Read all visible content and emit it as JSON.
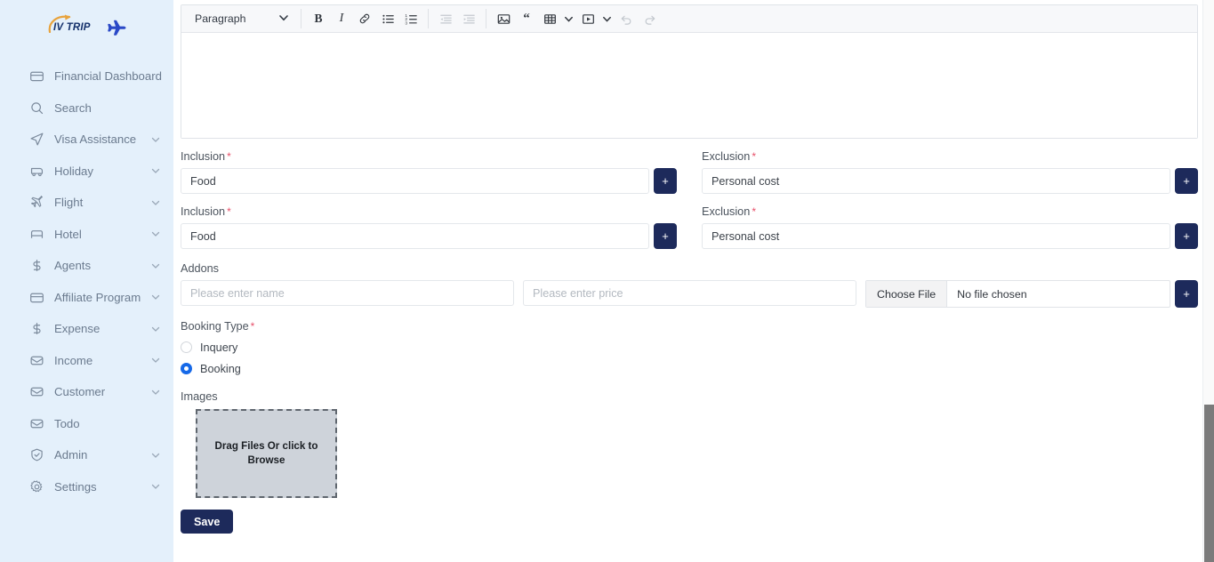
{
  "brand": {
    "name": "IV TRIP",
    "logo_icon": "plane-icon",
    "arc_icon": "curved-arrow-icon",
    "accent_blue": "#1d2a5b",
    "sidebar_bg": "#e4f0fb"
  },
  "sidebar": {
    "items": [
      {
        "label": "Financial Dashboard",
        "icon": "card-icon",
        "caret": false
      },
      {
        "label": "Search",
        "icon": "search-icon",
        "caret": false
      },
      {
        "label": "Visa Assistance",
        "icon": "send-icon",
        "caret": true
      },
      {
        "label": "Holiday",
        "icon": "bus-icon",
        "caret": true
      },
      {
        "label": "Flight",
        "icon": "flight-icon",
        "caret": true
      },
      {
        "label": "Hotel",
        "icon": "bed-icon",
        "caret": true
      },
      {
        "label": "Agents",
        "icon": "dollar-icon",
        "caret": true
      },
      {
        "label": "Affiliate Program",
        "icon": "card-icon",
        "caret": true
      },
      {
        "label": "Expense",
        "icon": "dollar-icon",
        "caret": true
      },
      {
        "label": "Income",
        "icon": "inbox-icon",
        "caret": true
      },
      {
        "label": "Customer",
        "icon": "inbox-icon",
        "caret": true
      },
      {
        "label": "Todo",
        "icon": "inbox-icon",
        "caret": false
      },
      {
        "label": "Admin",
        "icon": "shield-check-icon",
        "caret": true
      },
      {
        "label": "Settings",
        "icon": "gear-icon",
        "caret": true
      }
    ]
  },
  "editor": {
    "block_format": "Paragraph",
    "content": "",
    "toolbar": [
      {
        "name": "bold-button",
        "glyph": "B",
        "disabled": false
      },
      {
        "name": "italic-button",
        "glyph": "I",
        "disabled": false
      },
      {
        "name": "link-button",
        "glyph": "link-icon",
        "disabled": false
      },
      {
        "name": "bullet-list-button",
        "glyph": "bullet-list-icon",
        "disabled": false
      },
      {
        "name": "numbered-list-button",
        "glyph": "numbered-list-icon",
        "disabled": false
      },
      {
        "name": "outdent-button",
        "glyph": "outdent-icon",
        "disabled": true
      },
      {
        "name": "indent-button",
        "glyph": "indent-icon",
        "disabled": true
      },
      {
        "name": "image-button",
        "glyph": "image-icon",
        "disabled": false
      },
      {
        "name": "blockquote-button",
        "glyph": "“",
        "disabled": false
      },
      {
        "name": "table-button",
        "glyph": "table-icon",
        "disabled": false
      },
      {
        "name": "media-button",
        "glyph": "media-icon",
        "disabled": false
      },
      {
        "name": "undo-button",
        "glyph": "undo-icon",
        "disabled": true
      },
      {
        "name": "redo-button",
        "glyph": "redo-icon",
        "disabled": true
      }
    ]
  },
  "form": {
    "inclusion_label": "Inclusion",
    "exclusion_label": "Exclusion",
    "required_mark": "*",
    "add_button_label": "+",
    "inclusions": [
      {
        "value": "Food"
      },
      {
        "value": "Food"
      }
    ],
    "exclusions": [
      {
        "value": "Personal cost"
      },
      {
        "value": "Personal cost"
      }
    ],
    "addons": {
      "label": "Addons",
      "name_placeholder": "Please enter name",
      "name_value": "",
      "price_placeholder": "Please enter price",
      "price_value": "",
      "file_button": "Choose File",
      "file_status": "No file chosen",
      "add_button_label": "+"
    },
    "booking_type": {
      "label": "Booking Type",
      "options": [
        {
          "label": "Inquery",
          "selected": false
        },
        {
          "label": "Booking",
          "selected": true
        }
      ]
    },
    "images": {
      "label": "Images",
      "dropzone_text": "Drag Files Or click to Browse"
    },
    "save_label": "Save"
  }
}
